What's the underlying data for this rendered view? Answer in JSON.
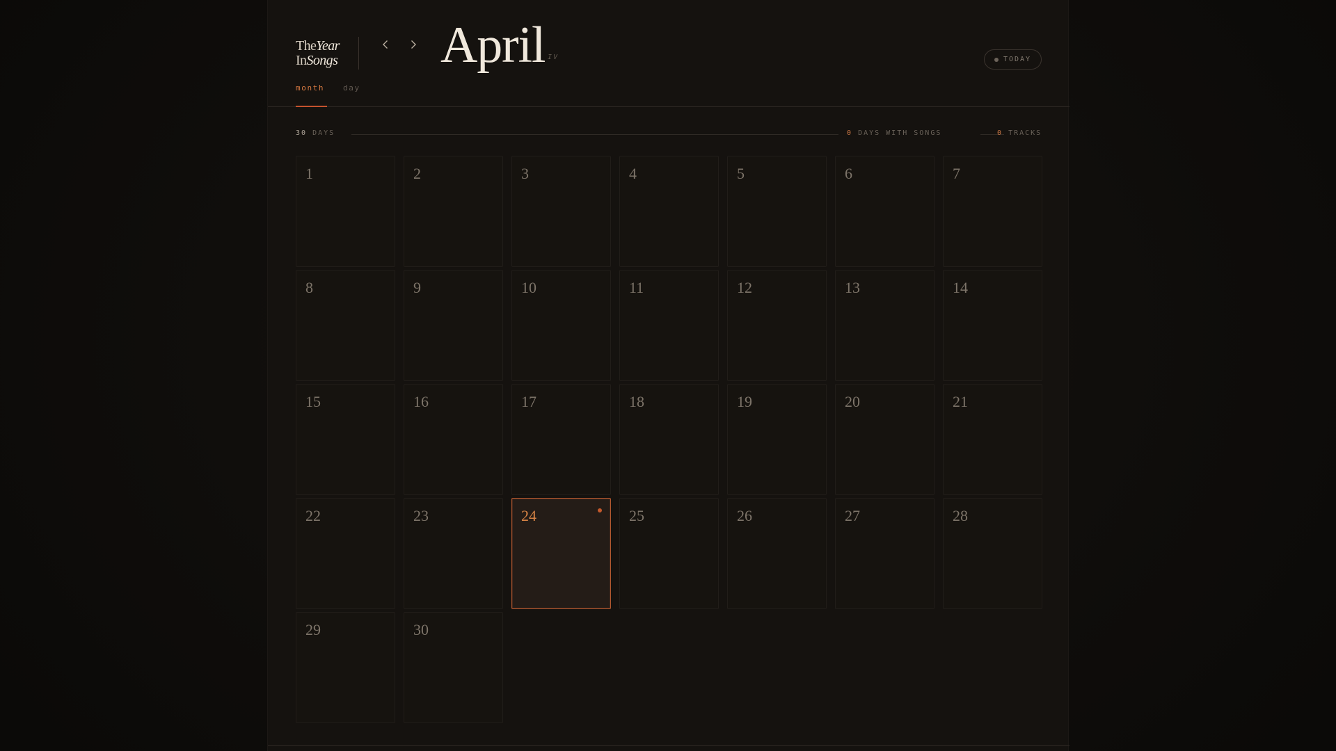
{
  "app": {
    "logo_line1_a": "The",
    "logo_line1_b": "Year",
    "logo_line2_a": "In",
    "logo_line2_b": "Songs"
  },
  "header": {
    "month": "April",
    "roman": "IV",
    "today_label": "TODAY",
    "prev_icon": "chevron-left-icon",
    "next_icon": "chevron-right-icon"
  },
  "tabs": [
    {
      "label": "month",
      "active": true
    },
    {
      "label": "day",
      "active": false
    }
  ],
  "stats": {
    "days_count": "30",
    "days_label": "DAYS",
    "days_with_songs_count": "0",
    "days_with_songs_label": "DAYS WITH SONGS",
    "tracks_count": "0",
    "tracks_label": "TRACKS"
  },
  "calendar": {
    "today": 24,
    "days": [
      "1",
      "2",
      "3",
      "4",
      "5",
      "6",
      "7",
      "8",
      "9",
      "10",
      "11",
      "12",
      "13",
      "14",
      "15",
      "16",
      "17",
      "18",
      "19",
      "20",
      "21",
      "22",
      "23",
      "24",
      "25",
      "26",
      "27",
      "28",
      "29",
      "30"
    ]
  },
  "colors": {
    "accent": "#c4522e",
    "today_number": "#d88445",
    "background": "#15120f"
  }
}
